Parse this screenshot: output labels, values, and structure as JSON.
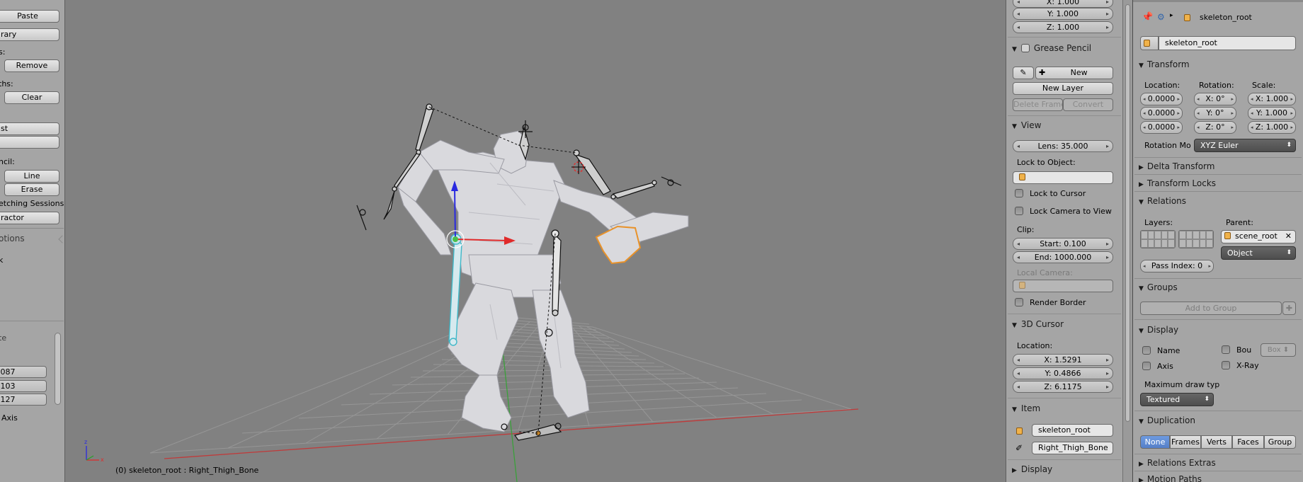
{
  "left_panel": {
    "paste_label": "Paste",
    "library_label": "rary",
    "s_label": "s:",
    "remove_label": "Remove",
    "ths_label": "ths:",
    "clear_label": "Clear",
    "list_label": "st",
    "pencil_label": "ncil:",
    "line_label": "Line",
    "erase_label": "Erase",
    "sketching_label": "etching Sessions",
    "ractor_label": "ractor",
    "options_label": "otions",
    "k_label": "k",
    "te_label": "te",
    "val1": ".087",
    "val2": ".103",
    "val3": ".127",
    "axis_label": "Axis"
  },
  "viewport": {
    "status_text": "(0) skeleton_root : Right_Thigh_Bone"
  },
  "n_panel": {
    "top_x": "X: 1.000",
    "top_y": "Y: 1.000",
    "top_z": "Z: 1.000",
    "grease_pencil": {
      "title": "Grease Pencil",
      "new_label": "New",
      "new_layer_label": "New Layer",
      "delete_frame_label": "Delete Frame",
      "convert_label": "Convert"
    },
    "view": {
      "title": "View",
      "lens": "Lens: 35.000",
      "lock_object_label": "Lock to Object:",
      "lock_cursor_label": "Lock to Cursor",
      "lock_camera_label": "Lock Camera to View",
      "clip_label": "Clip:",
      "clip_start": "Start: 0.100",
      "clip_end": "End: 1000.000",
      "local_camera_label": "Local Camera:",
      "render_border_label": "Render Border"
    },
    "cursor": {
      "title": "3D Cursor",
      "location_label": "Location:",
      "x": "X: 1.5291",
      "y": "Y: 0.4866",
      "z": "Z: 6.1175"
    },
    "item": {
      "title": "Item",
      "object_name": "skeleton_root",
      "bone_name": "Right_Thigh_Bone"
    },
    "display_title": "Display"
  },
  "properties": {
    "header_name": "skeleton_root",
    "object_name": "skeleton_root",
    "transform": {
      "title": "Transform",
      "location_label": "Location:",
      "rotation_label": "Rotation:",
      "scale_label": "Scale:",
      "loc": [
        "0.0000",
        "0.0000",
        "0.0000"
      ],
      "rot": [
        "X: 0°",
        "Y: 0°",
        "Z: 0°"
      ],
      "scale": [
        "X: 1.000",
        "Y: 1.000",
        "Z: 1.000"
      ],
      "rotation_mode_label": "Rotation Mo",
      "rotation_mode_value": "XYZ Euler"
    },
    "delta_transform_title": "Delta Transform",
    "transform_locks_title": "Transform Locks",
    "relations": {
      "title": "Relations",
      "layers_label": "Layers:",
      "parent_label": "Parent:",
      "parent_value": "scene_root",
      "parent_type": "Object",
      "pass_index": "Pass Index: 0"
    },
    "groups": {
      "title": "Groups",
      "add_label": "Add to Group"
    },
    "display": {
      "title": "Display",
      "name_label": "Name",
      "bou_label": "Bou",
      "box_label": "Box",
      "axis_label": "Axis",
      "xray_label": "X-Ray",
      "max_draw_label": "Maximum draw typ",
      "max_draw_value": "Textured"
    },
    "duplication": {
      "title": "Duplication",
      "options": [
        "None",
        "Frames",
        "Verts",
        "Faces",
        "Group"
      ]
    },
    "relations_extras_title": "Relations Extras",
    "motion_paths_title": "Motion Paths"
  }
}
